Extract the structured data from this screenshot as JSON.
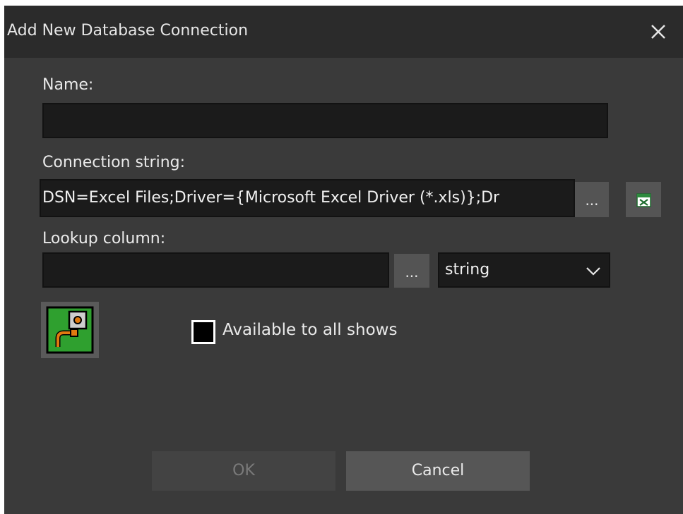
{
  "dialog": {
    "title": "Add New Database Connection",
    "close_icon": "close-icon"
  },
  "name": {
    "label": "Name:",
    "value": ""
  },
  "connection": {
    "label": "Connection string:",
    "value": "DSN=Excel Files;Driver={Microsoft Excel Driver (*.xls)};Dr",
    "browse_label": "...",
    "excel_icon": "excel-icon"
  },
  "lookup": {
    "label": "Lookup column:",
    "value": "",
    "browse_label": "...",
    "type_selected": "string"
  },
  "plugin_icon": "plugin-connection-icon",
  "shared": {
    "label": "Available to all shows",
    "checked": false
  },
  "buttons": {
    "ok": "OK",
    "cancel": "Cancel"
  },
  "colors": {
    "background": "#3a3a3a",
    "titlebar": "#2b2b2b",
    "field": "#1b1b1b",
    "plugin_green": "#2fa02f",
    "plugin_orange": "#e07a10"
  }
}
